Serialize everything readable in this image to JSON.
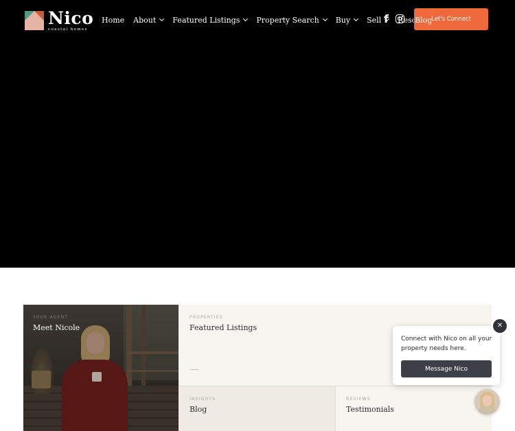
{
  "header": {
    "logo": {
      "name": "Nico",
      "tagline": "coastal homes"
    },
    "nav": [
      {
        "label": "Home",
        "dropdown": false
      },
      {
        "label": "About",
        "dropdown": true
      },
      {
        "label": "Featured Listings",
        "dropdown": true
      },
      {
        "label": "Property Search",
        "dropdown": true
      },
      {
        "label": "Buy",
        "dropdown": true
      },
      {
        "label": "Sell",
        "dropdown": true
      },
      {
        "label": "Resources",
        "dropdown": false
      }
    ],
    "social": {
      "facebook_glyph": "f",
      "icons": [
        "facebook-icon",
        "instagram-icon"
      ]
    },
    "blog_label": "Blog",
    "cta_label": "Let's Connect",
    "cta_color": "#ee6a3c"
  },
  "cards": {
    "meet": {
      "eyebrow": "YOUR AGENT",
      "title": "Meet Nicole"
    },
    "properties": {
      "eyebrow": "PROPERTIES",
      "title": "Featured Listings"
    },
    "insights": {
      "eyebrow": "INSIGHTS",
      "title": "Blog"
    },
    "reviews": {
      "eyebrow": "REVIEWS",
      "title": "Testimonials"
    }
  },
  "chat": {
    "message": "Connect with Nico on all your property needs here.",
    "button_label": "Message Nico",
    "close_glyph": "✕"
  }
}
